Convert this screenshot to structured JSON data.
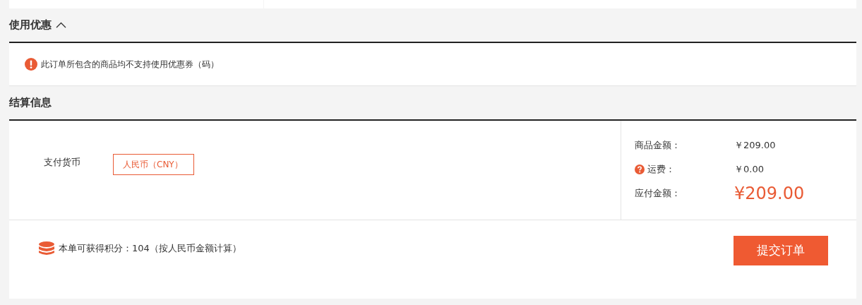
{
  "coupon_section": {
    "title": "使用优惠",
    "expanded": true,
    "notice": "此订单所包含的商品均不支持使用优惠券（码）"
  },
  "settlement_section": {
    "title": "结算信息",
    "currency": {
      "label": "支付货币",
      "value": "人民币（CNY）"
    },
    "summary": [
      {
        "kind": "plain",
        "label": "商品金额：",
        "value": "￥209.00"
      },
      {
        "kind": "help",
        "label": "运费：",
        "value": "￥0.00"
      },
      {
        "kind": "total",
        "label": "应付金额：",
        "value": "¥209.00"
      }
    ],
    "points": "本单可获得积分：104（按人民币金额计算）",
    "submit": "提交订单"
  }
}
